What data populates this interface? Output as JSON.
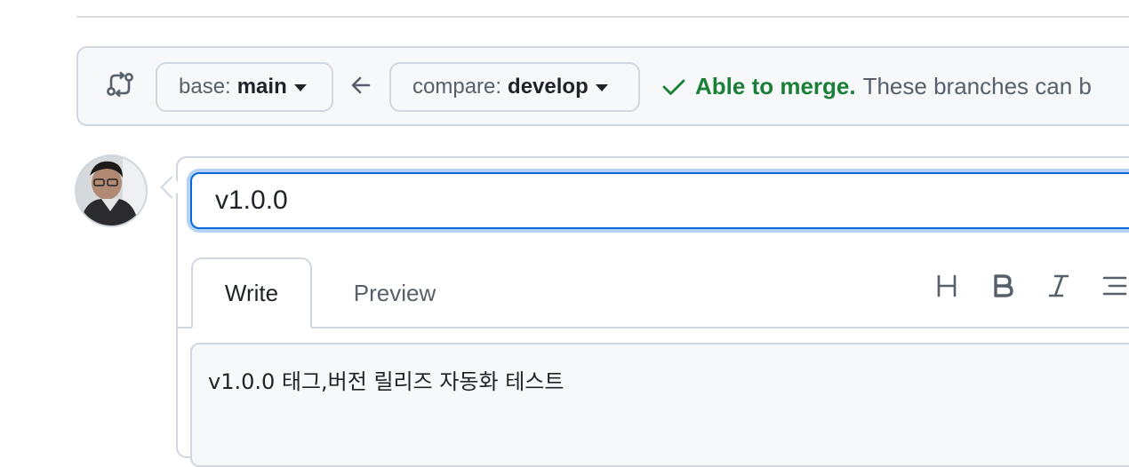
{
  "range": {
    "base_prefix": "base:",
    "base_branch": "main",
    "compare_prefix": "compare:",
    "compare_branch": "develop",
    "merge_status": "Able to merge.",
    "merge_message": "These branches can b"
  },
  "icons": {
    "compare": "git-compare-icon",
    "arrow": "arrow-left-icon",
    "check": "check-icon",
    "heading": "heading-icon",
    "bold": "bold-icon",
    "italic": "italic-icon",
    "list": "list-icon"
  },
  "pr": {
    "title_value": "v1.0.0",
    "tabs": [
      {
        "label": "Write"
      },
      {
        "label": "Preview"
      }
    ],
    "body": "v1.0.0 태그,버전 릴리즈 자동화 테스트"
  },
  "colors": {
    "accent": "#0969da",
    "success": "#1a7f37",
    "border": "#d0d7de",
    "muted": "#57606a"
  }
}
